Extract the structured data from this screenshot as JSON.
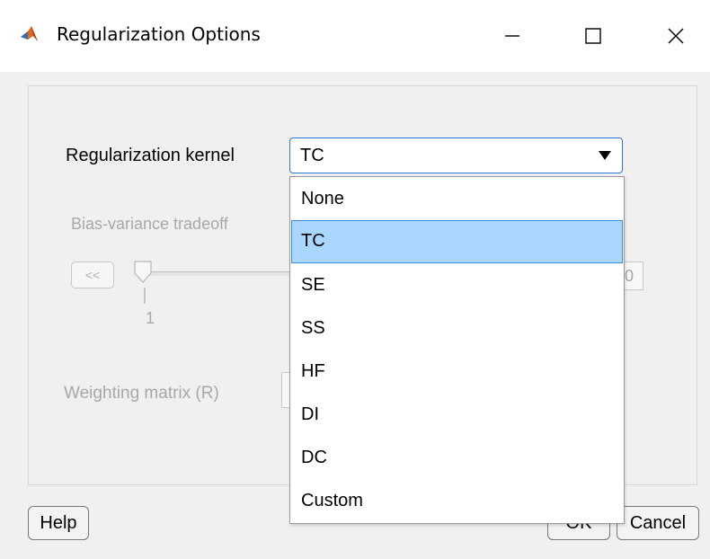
{
  "window": {
    "title": "Regularization Options",
    "icon": "matlab-icon",
    "controls": {
      "minimize": "minimize-icon",
      "maximize": "maximize-icon",
      "close": "close-icon"
    }
  },
  "form": {
    "kernel_label": "Regularization kernel",
    "kernel_selected": "TC",
    "kernel_options": [
      "None",
      "TC",
      "SE",
      "SS",
      "HF",
      "DI",
      "DC",
      "Custom"
    ],
    "bias_label": "Bias-variance tradeoff",
    "slider_prev_label": "<<",
    "slider_min_label": "1",
    "slider_value_tail": "0",
    "weighting_label": "Weighting matrix (R)"
  },
  "buttons": {
    "help": "Help",
    "ok": "OK",
    "cancel": "Cancel"
  },
  "colors": {
    "selection": "#a9d7ff",
    "focus_border": "#2a75d6",
    "disabled_text": "#a8a8a8"
  }
}
